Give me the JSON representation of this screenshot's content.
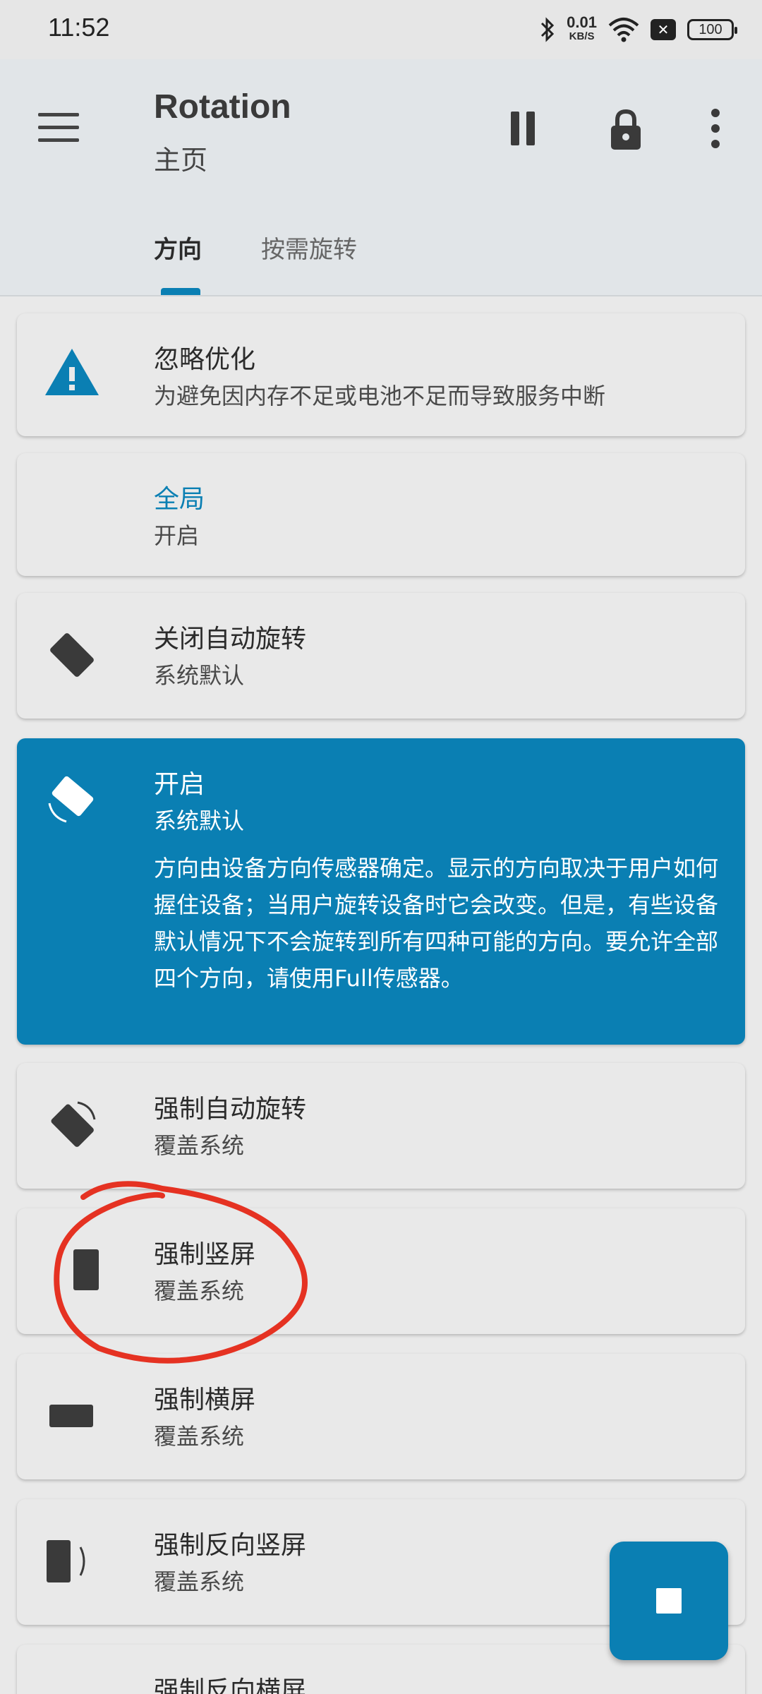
{
  "status_bar": {
    "time": "11:52",
    "speed_value": "0.01",
    "speed_unit": "KB/S",
    "battery": "100"
  },
  "app_bar": {
    "title": "Rotation",
    "subtitle": "主页",
    "tabs": [
      {
        "label": "方向",
        "active": true
      },
      {
        "label": "按需旋转",
        "active": false
      }
    ]
  },
  "cards": [
    {
      "title": "忽略优化",
      "subtitle": "为避免因内存不足或电池不足而导致服务中断",
      "icon": "warning-icon"
    },
    {
      "title": "全局",
      "subtitle": "开启"
    },
    {
      "title": "关闭自动旋转",
      "subtitle": "系统默认",
      "icon": "phone-tilted-icon"
    },
    {
      "title": "开启",
      "subtitle": "系统默认",
      "description": "方向由设备方向传感器确定。显示的方向取决于用户如何握住设备；当用户旋转设备时它会改变。但是，有些设备默认情况下不会旋转到所有四种可能的方向。要允许全部四个方向，请使用Full传感器。",
      "icon": "auto-rotate-icon",
      "selected": true
    },
    {
      "title": "强制自动旋转",
      "subtitle": "覆盖系统",
      "icon": "force-rotate-icon"
    },
    {
      "title": "强制竖屏",
      "subtitle": "覆盖系统",
      "icon": "portrait-icon"
    },
    {
      "title": "强制横屏",
      "subtitle": "覆盖系统",
      "icon": "landscape-icon"
    },
    {
      "title": "强制反向竖屏",
      "subtitle": "覆盖系统",
      "icon": "reverse-portrait-icon"
    },
    {
      "title": "强制反向横屏",
      "subtitle": "",
      "icon": "reverse-landscape-icon"
    }
  ],
  "colors": {
    "accent": "#0a7fb3",
    "annotation": "#e53222"
  }
}
